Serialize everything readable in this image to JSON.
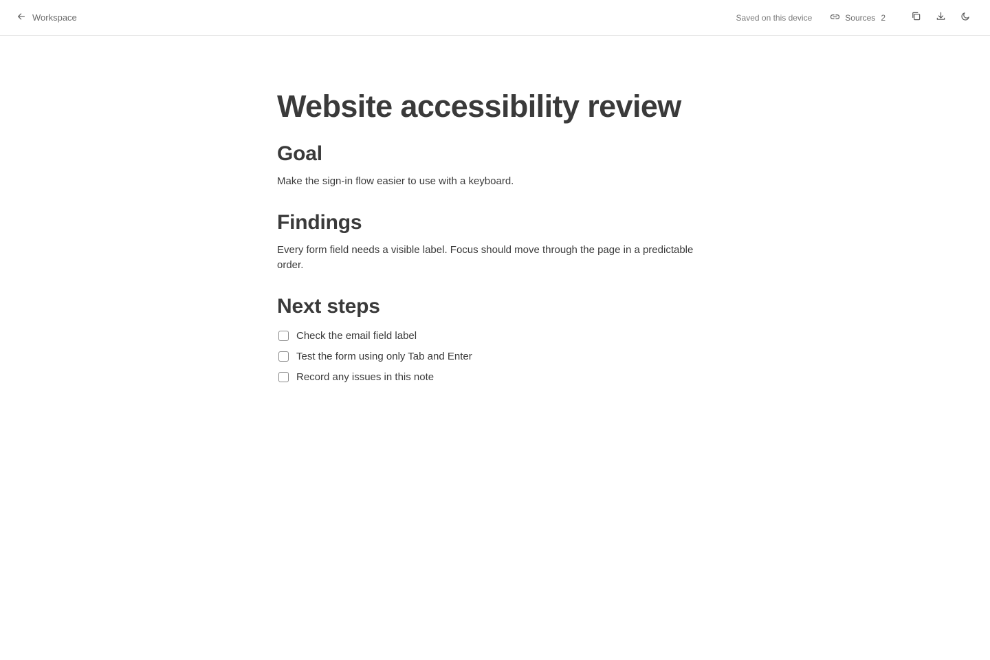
{
  "topbar": {
    "back_label": "Workspace",
    "saved_status": "Saved on this device",
    "sources_label": "Sources",
    "sources_count": "2",
    "icons": [
      "arrow-left-icon",
      "link-icon",
      "copy-icon",
      "download-icon",
      "moon-icon"
    ]
  },
  "document": {
    "title": "Website accessibility review",
    "sections": [
      {
        "heading": "Goal",
        "body": "Make the sign-in flow easier to use with a keyboard."
      },
      {
        "heading": "Findings",
        "body": "Every form field needs a visible label. Focus should move through the page in a predictable order."
      },
      {
        "heading": "Next steps",
        "tasks": [
          {
            "label": "Check the email field label",
            "checked": false
          },
          {
            "label": "Test the form using only Tab and Enter",
            "checked": false
          },
          {
            "label": "Record any issues in this note",
            "checked": false
          }
        ]
      }
    ]
  },
  "colors": {
    "text": "#3a3a3a",
    "muted": "#6b6b6b",
    "border": "#e6e6e6",
    "background": "#ffffff"
  }
}
